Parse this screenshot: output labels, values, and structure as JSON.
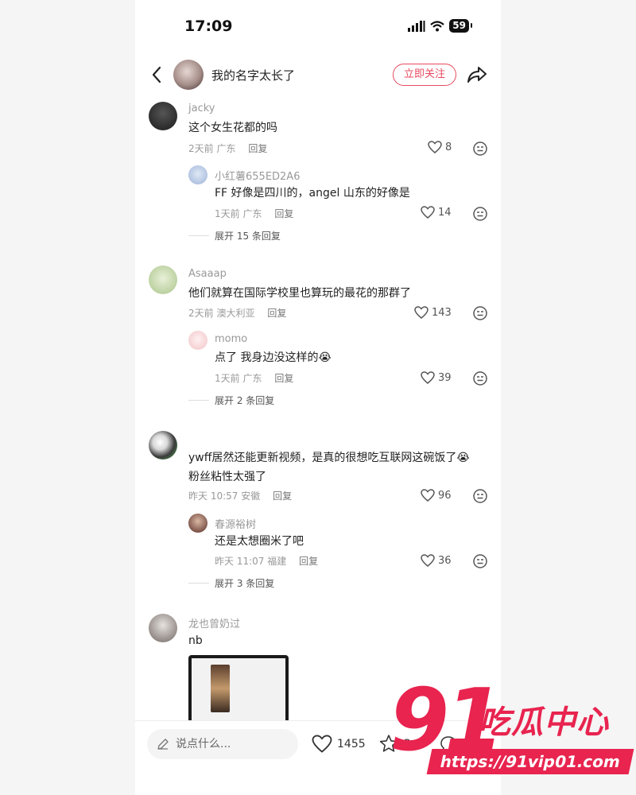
{
  "status": {
    "time": "17:09",
    "battery": "59"
  },
  "header": {
    "username": "我的名字太长了",
    "follow_label": "立即关注"
  },
  "comments": [
    {
      "user": "jacky",
      "text": "这个女生花都的吗",
      "time": "2天前",
      "location": "广东",
      "reply_label": "回复",
      "likes": "8",
      "reply": {
        "user": "小红薯655ED2A6",
        "text": "FF 好像是四川的，angel 山东的好像是",
        "time": "1天前",
        "location": "广东",
        "reply_label": "回复",
        "likes": "14"
      },
      "expand": "展开 15 条回复"
    },
    {
      "user": "Asaaap",
      "text": "他们就算在国际学校里也算玩的最花的那群了",
      "time": "2天前",
      "location": "澳大利亚",
      "reply_label": "回复",
      "likes": "143",
      "reply": {
        "user": "momo",
        "text": "点了 我身边没这样的😭",
        "time": "1天前",
        "location": "广东",
        "reply_label": "回复",
        "likes": "39"
      },
      "expand": "展开 2 条回复"
    },
    {
      "user": "",
      "text_line1": "ywff居然还能更新视频，是真的很想吃互联网这碗饭了😭",
      "text_line2": "粉丝粘性太强了",
      "time": "昨天 10:57",
      "location": "安徽",
      "reply_label": "回复",
      "likes": "96",
      "reply": {
        "user": "春源裕树",
        "text": "还是太想圈米了吧",
        "time": "昨天 11:07",
        "location": "福建",
        "reply_label": "回复",
        "likes": "36"
      },
      "expand": "展开 3 条回复"
    },
    {
      "user": "龙也曾奶过",
      "text": "nb"
    }
  ],
  "bottom_bar": {
    "input_placeholder": "说点什么...",
    "likes": "1455",
    "stars": "2",
    "comments": "126"
  },
  "watermark": {
    "number": "91",
    "name": "吃瓜中心",
    "url": "https://91vip01.com"
  },
  "colors": {
    "accent": "#e84a5f",
    "watermark": "#e8244f"
  }
}
